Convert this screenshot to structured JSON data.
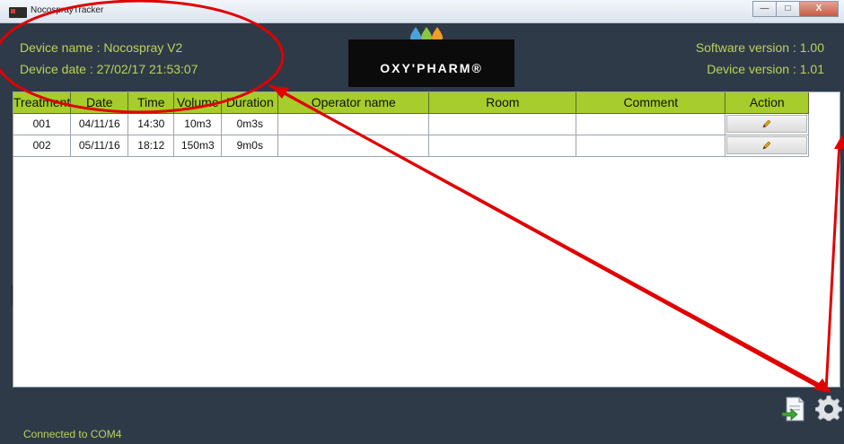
{
  "window": {
    "title": "NocosprayTracker",
    "minimize_glyph": "—",
    "maximize_glyph": "□",
    "close_glyph": "X"
  },
  "header": {
    "device_name_label": "Device name : ",
    "device_name_value": "Nocospray V2",
    "device_date_label": "Device date : ",
    "device_date_value": "27/02/17 21:53:07",
    "software_version_label": "Software version : ",
    "software_version_value": "1.00",
    "device_version_label": "Device version : ",
    "device_version_value": "1.01",
    "logo_text": "OXY'PHARM®"
  },
  "table": {
    "columns": [
      "Treatment",
      "Date",
      "Time",
      "Volume",
      "Duration",
      "Operator name",
      "Room",
      "Comment",
      "Action"
    ],
    "rows": [
      {
        "treatment": "001",
        "date": "04/11/16",
        "time": "14:30",
        "volume": "10m3",
        "duration": "0m3s",
        "operator": "",
        "room": "",
        "comment": ""
      },
      {
        "treatment": "002",
        "date": "05/11/16",
        "time": "18:12",
        "volume": "150m3",
        "duration": "9m0s",
        "operator": "",
        "room": "",
        "comment": ""
      }
    ]
  },
  "footer": {
    "status": "Connected to COM4"
  },
  "icons": {
    "edit": "pencil-icon",
    "export": "export-file-icon",
    "settings": "gear-icon"
  },
  "colors": {
    "frame": "#2f3a48",
    "accent_text": "#b9d35a",
    "table_header": "#a6cd2c",
    "annotation": "#e00000"
  }
}
